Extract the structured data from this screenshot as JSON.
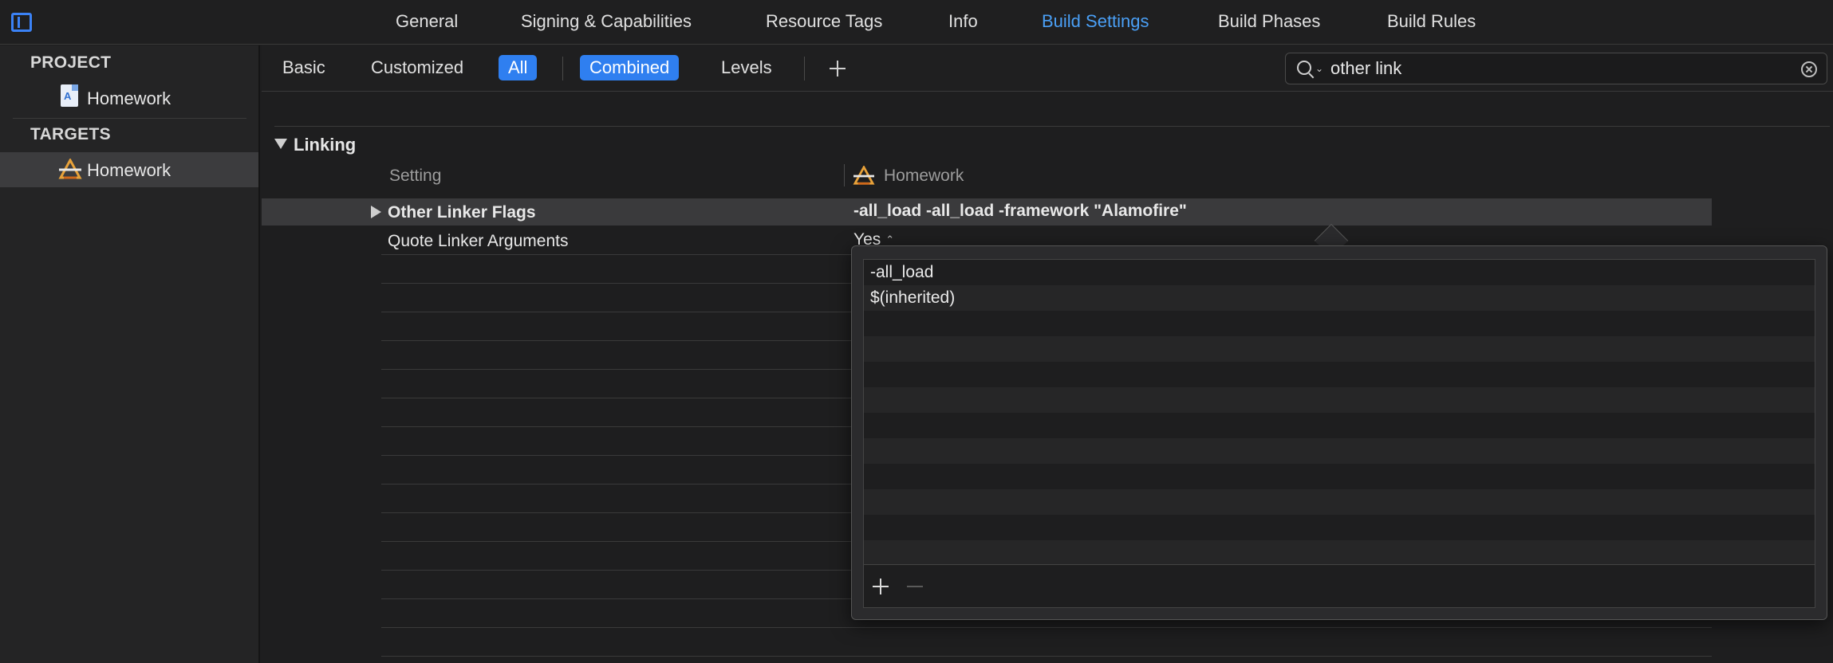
{
  "tabs": [
    {
      "label": "General",
      "active": false
    },
    {
      "label": "Signing & Capabilities",
      "active": false
    },
    {
      "label": "Resource Tags",
      "active": false
    },
    {
      "label": "Info",
      "active": false
    },
    {
      "label": "Build Settings",
      "active": true
    },
    {
      "label": "Build Phases",
      "active": false
    },
    {
      "label": "Build Rules",
      "active": false
    }
  ],
  "sidebar": {
    "project_section": "PROJECT",
    "project_item": "Homework",
    "targets_section": "TARGETS",
    "target_item": "Homework"
  },
  "filter": {
    "basic": "Basic",
    "customized": "Customized",
    "all": "All",
    "combined": "Combined",
    "levels": "Levels",
    "search_value": "other link"
  },
  "section": {
    "title": "Linking",
    "col_setting": "Setting",
    "col_target": "Homework"
  },
  "rows": [
    {
      "name": "Other Linker Flags",
      "value": "-all_load -all_load -framework \"Alamofire\""
    },
    {
      "name": "Quote Linker Arguments",
      "value": "Yes"
    }
  ],
  "popover": {
    "items": [
      "-all_load",
      "$(inherited)"
    ]
  },
  "colors": {
    "accent": "#2f7ff0",
    "active_tab": "#4a9ff5",
    "background": "#1e1e1f"
  }
}
